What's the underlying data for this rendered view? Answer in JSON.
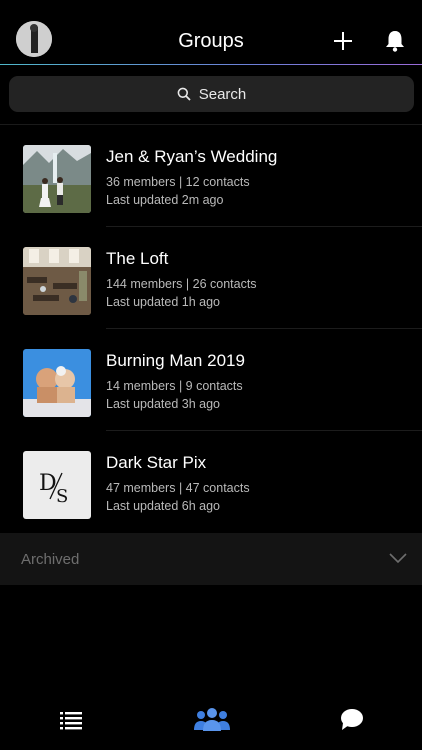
{
  "header": {
    "title": "Groups",
    "accent_gradient": [
      "#4fb7c9",
      "#6d7fd8",
      "#9a6bd8"
    ]
  },
  "search": {
    "label": "Search"
  },
  "groups": [
    {
      "name": "Jen & Ryan’s Wedding",
      "members": "36 members | 12 contacts",
      "updated": "Last updated 2m ago",
      "thumb": "wedding-photo"
    },
    {
      "name": "The Loft",
      "members": "144 members | 26 contacts",
      "updated": "Last updated 1h ago",
      "thumb": "loft-photo"
    },
    {
      "name": "Burning Man 2019",
      "members": "14 members | 9 contacts",
      "updated": "Last updated 3h ago",
      "thumb": "burning-man-photo"
    },
    {
      "name": "Dark Star Pix",
      "members": "47 members | 47 contacts",
      "updated": "Last updated 6h ago",
      "thumb": "ds-logo",
      "thumb_text": "D/S"
    }
  ],
  "archived": {
    "label": "Archived"
  },
  "tabbar": {
    "items": [
      {
        "icon": "list-icon",
        "active": false
      },
      {
        "icon": "groups-icon",
        "active": true,
        "color": "#3f7fe0"
      },
      {
        "icon": "chat-icon",
        "active": false
      }
    ]
  }
}
